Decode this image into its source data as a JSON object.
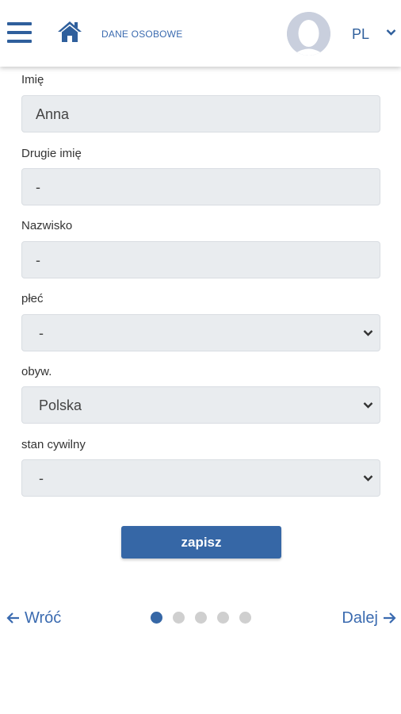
{
  "header": {
    "title": "DANE OSOBOWE",
    "language": "PL",
    "icons": [
      "hamburger-menu-icon",
      "home-icon",
      "avatar",
      "chevron-down-icon"
    ]
  },
  "form": {
    "first_name": {
      "label": "Imię",
      "value": "Anna"
    },
    "middle_name": {
      "label": "Drugie imię",
      "value": "-"
    },
    "last_name": {
      "label": "Nazwisko",
      "value": "-"
    },
    "gender": {
      "label": "płeć",
      "value": "-"
    },
    "citizenship": {
      "label": "obyw.",
      "value": "Polska"
    },
    "marital_status": {
      "label": "stan cywilny",
      "value": "-"
    },
    "save_label": "zapisz"
  },
  "pagination": {
    "back_label": "Wróć",
    "next_label": "Dalej",
    "total_steps": 5,
    "current_step": 1
  },
  "colors": {
    "accent": "#3667a6",
    "field_bg": "#e9ecef",
    "inactive_dot": "#cfcfcf"
  }
}
